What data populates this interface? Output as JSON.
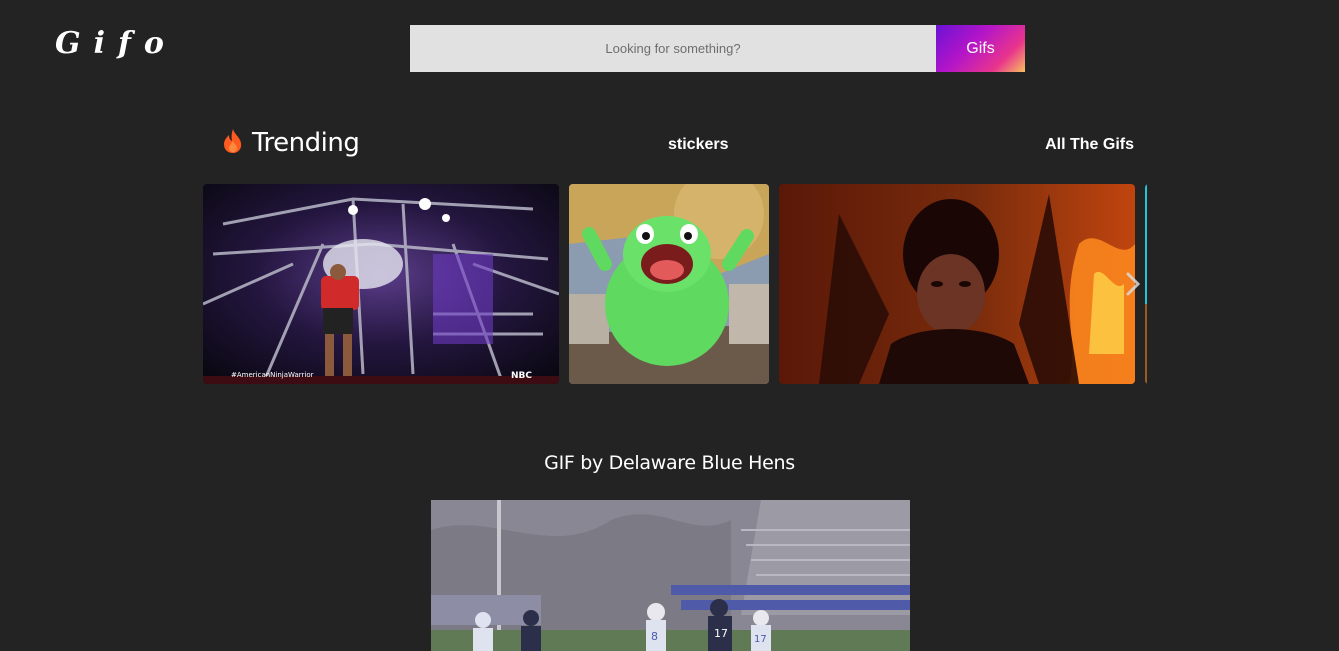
{
  "header": {
    "logo": "Gifo",
    "search": {
      "placeholder": "Looking for something?",
      "value": "",
      "button_label": "Gifs"
    }
  },
  "nav": {
    "trending_icon": "fire-icon",
    "trending_label": "Trending",
    "stickers_label": "stickers",
    "all_gifs_label": "All The Gifs"
  },
  "trending_carousel": {
    "items": [
      {
        "icon": "gif-image",
        "caption_left": "#AmericanNinjaWarrior",
        "caption_right": "NBC"
      },
      {
        "icon": "gif-image"
      },
      {
        "icon": "gif-image"
      },
      {
        "icon": "gif-image"
      }
    ],
    "next_icon": "chevron-right-icon"
  },
  "featured": {
    "title": "GIF by Delaware Blue Hens",
    "jersey_numbers": [
      "8",
      "17",
      "17"
    ]
  },
  "colors": {
    "background": "#232323",
    "search_field": "#e1e1e1",
    "button_gradient_start": "#6a12d4",
    "button_gradient_end": "#f8c05d",
    "fire": "#ff5a1f"
  }
}
